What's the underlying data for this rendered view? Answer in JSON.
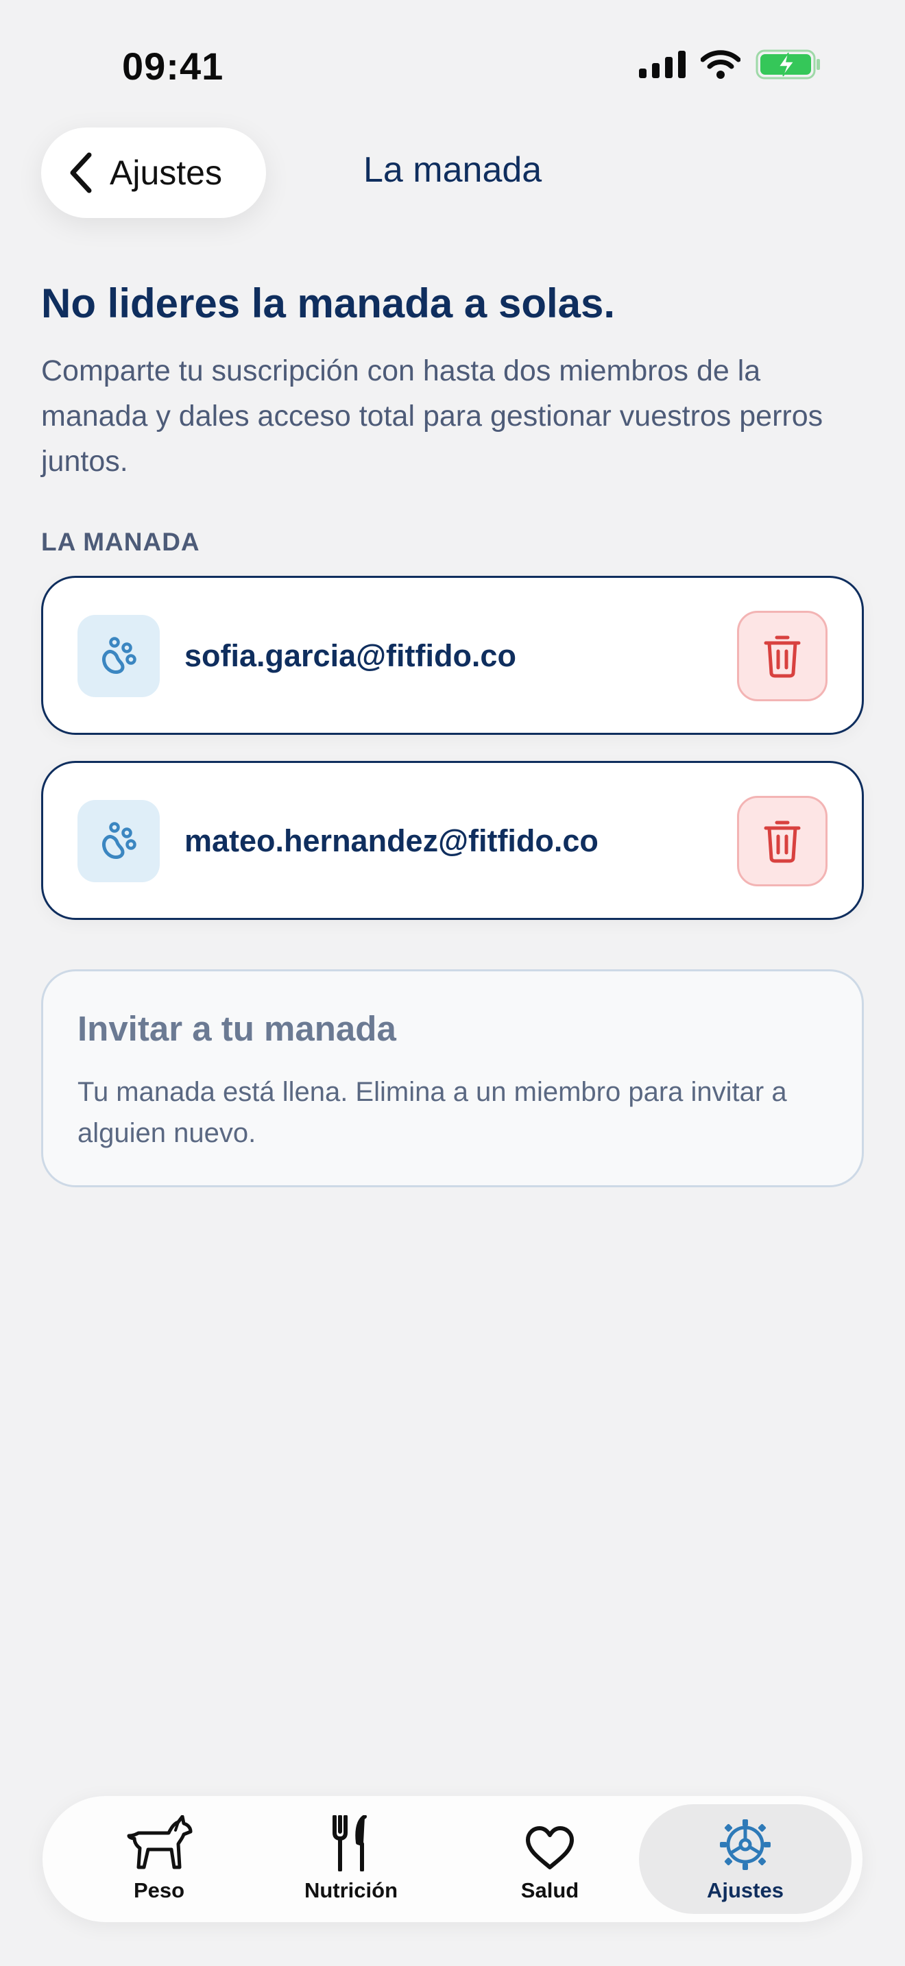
{
  "status_bar": {
    "time": "09:41"
  },
  "header": {
    "back_label": "Ajustes",
    "title": "La manada"
  },
  "intro": {
    "headline": "No lideres la manada a solas.",
    "description": "Comparte tu suscripción con hasta dos miembros de la manada y dales acceso total para gestionar vuestros perros juntos."
  },
  "members": {
    "section_label": "LA MANADA",
    "items": [
      {
        "email": "sofia.garcia@fitfido.co",
        "icon": "paw-icon"
      },
      {
        "email": "mateo.hernandez@fitfido.co",
        "icon": "paw-icon"
      }
    ]
  },
  "invite": {
    "title": "Invitar a tu manada",
    "text": "Tu manada está llena. Elimina a un miembro para invitar a alguien nuevo."
  },
  "tab_bar": {
    "tabs": [
      {
        "label": "Peso",
        "icon": "dog-icon"
      },
      {
        "label": "Nutrición",
        "icon": "fork-knife-icon"
      },
      {
        "label": "Salud",
        "icon": "heart-icon"
      },
      {
        "label": "Ajustes",
        "icon": "gear-icon",
        "active": true
      }
    ]
  },
  "colors": {
    "primary": "#0f2e5e",
    "paw": "#3b86c1",
    "delete": "#d8413f",
    "battery": "#35c759"
  }
}
